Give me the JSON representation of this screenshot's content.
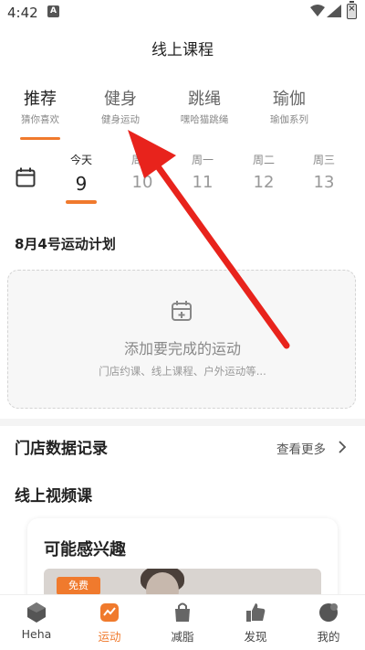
{
  "status": {
    "time": "4:42",
    "a_badge": "A"
  },
  "header": {
    "title": "线上课程"
  },
  "tabs": [
    {
      "label": "推荐",
      "sub": "猜你喜欢"
    },
    {
      "label": "健身",
      "sub": "健身运动"
    },
    {
      "label": "跳绳",
      "sub": "嘿哈猫跳绳"
    },
    {
      "label": "瑜伽",
      "sub": "瑜伽系列"
    }
  ],
  "days": [
    {
      "label": "今天",
      "num": "9"
    },
    {
      "label": "周日",
      "num": "10"
    },
    {
      "label": "周一",
      "num": "11"
    },
    {
      "label": "周二",
      "num": "12"
    },
    {
      "label": "周三",
      "num": "13"
    }
  ],
  "plan": {
    "title": "8月4号运动计划",
    "add_title": "添加要完成的运动",
    "add_sub": "门店约课、线上课程、户外运动等..."
  },
  "store": {
    "title": "门店数据记录",
    "more": "查看更多"
  },
  "video": {
    "title": "线上视频课",
    "card_title": "可能感兴趣",
    "badge": "免费"
  },
  "nav": [
    {
      "label": "Heha"
    },
    {
      "label": "运动"
    },
    {
      "label": "减脂"
    },
    {
      "label": "发现"
    },
    {
      "label": "我的"
    }
  ],
  "colors": {
    "accent": "#f07a2d",
    "annotation": "#e8231c"
  }
}
